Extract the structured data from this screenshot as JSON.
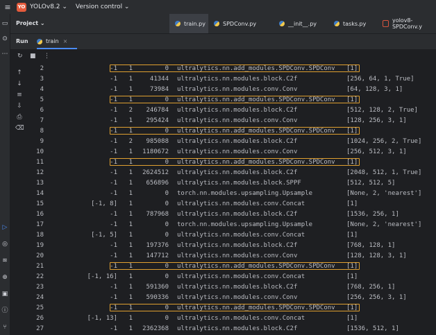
{
  "topbar": {
    "project_badge": "YO",
    "project_name": "YOLOv8.2 ⌄",
    "version_control": "Version control ⌄"
  },
  "editor": {
    "project_label": "Project ⌄",
    "tabs": [
      {
        "label": "train.py",
        "kind": "py"
      },
      {
        "label": "SPDConv.py",
        "kind": "py"
      },
      {
        "label": "__init__.py",
        "kind": "py"
      },
      {
        "label": "tasks.py",
        "kind": "py"
      },
      {
        "label": "yolov8-SPDConv.y",
        "kind": "yaml"
      }
    ]
  },
  "run": {
    "label": "Run",
    "tab": "train",
    "close": "×"
  },
  "colors": {
    "highlight": "#e0a030",
    "accent": "#4b8cf7"
  },
  "rows": [
    {
      "ln": "2",
      "from": "-1",
      "n": "1",
      "params": "0",
      "module": "ultralytics.nn.add_modules.SPDConv.SPDConv",
      "args": "[1]",
      "hl": true
    },
    {
      "ln": "3",
      "from": "-1",
      "n": "1",
      "params": "41344",
      "module": "ultralytics.nn.modules.block.C2f",
      "args": "[256, 64, 1, True]",
      "hl": false
    },
    {
      "ln": "4",
      "from": "-1",
      "n": "1",
      "params": "73984",
      "module": "ultralytics.nn.modules.conv.Conv",
      "args": "[64, 128, 3, 1]",
      "hl": false
    },
    {
      "ln": "5",
      "from": "-1",
      "n": "1",
      "params": "0",
      "module": "ultralytics.nn.add_modules.SPDConv.SPDConv",
      "args": "[1]",
      "hl": true
    },
    {
      "ln": "6",
      "from": "-1",
      "n": "2",
      "params": "246784",
      "module": "ultralytics.nn.modules.block.C2f",
      "args": "[512, 128, 2, True]",
      "hl": false
    },
    {
      "ln": "7",
      "from": "-1",
      "n": "1",
      "params": "295424",
      "module": "ultralytics.nn.modules.conv.Conv",
      "args": "[128, 256, 3, 1]",
      "hl": false
    },
    {
      "ln": "8",
      "from": "-1",
      "n": "1",
      "params": "0",
      "module": "ultralytics.nn.add_modules.SPDConv.SPDConv",
      "args": "[1]",
      "hl": true
    },
    {
      "ln": "9",
      "from": "-1",
      "n": "2",
      "params": "985088",
      "module": "ultralytics.nn.modules.block.C2f",
      "args": "[1024, 256, 2, True]",
      "hl": false
    },
    {
      "ln": "10",
      "from": "-1",
      "n": "1",
      "params": "1180672",
      "module": "ultralytics.nn.modules.conv.Conv",
      "args": "[256, 512, 3, 1]",
      "hl": false
    },
    {
      "ln": "11",
      "from": "-1",
      "n": "1",
      "params": "0",
      "module": "ultralytics.nn.add_modules.SPDConv.SPDConv",
      "args": "[1]",
      "hl": true
    },
    {
      "ln": "12",
      "from": "-1",
      "n": "1",
      "params": "2624512",
      "module": "ultralytics.nn.modules.block.C2f",
      "args": "[2048, 512, 1, True]",
      "hl": false
    },
    {
      "ln": "13",
      "from": "-1",
      "n": "1",
      "params": "656896",
      "module": "ultralytics.nn.modules.block.SPPF",
      "args": "[512, 512, 5]",
      "hl": false
    },
    {
      "ln": "14",
      "from": "-1",
      "n": "1",
      "params": "0",
      "module": "torch.nn.modules.upsampling.Upsample",
      "args": "[None, 2, 'nearest']",
      "hl": false
    },
    {
      "ln": "15",
      "from": "[-1, 8]",
      "n": "1",
      "params": "0",
      "module": "ultralytics.nn.modules.conv.Concat",
      "args": "[1]",
      "hl": false
    },
    {
      "ln": "16",
      "from": "-1",
      "n": "1",
      "params": "787968",
      "module": "ultralytics.nn.modules.block.C2f",
      "args": "[1536, 256, 1]",
      "hl": false
    },
    {
      "ln": "17",
      "from": "-1",
      "n": "1",
      "params": "0",
      "module": "torch.nn.modules.upsampling.Upsample",
      "args": "[None, 2, 'nearest']",
      "hl": false
    },
    {
      "ln": "18",
      "from": "[-1, 5]",
      "n": "1",
      "params": "0",
      "module": "ultralytics.nn.modules.conv.Concat",
      "args": "[1]",
      "hl": false
    },
    {
      "ln": "19",
      "from": "-1",
      "n": "1",
      "params": "197376",
      "module": "ultralytics.nn.modules.block.C2f",
      "args": "[768, 128, 1]",
      "hl": false
    },
    {
      "ln": "20",
      "from": "-1",
      "n": "1",
      "params": "147712",
      "module": "ultralytics.nn.modules.conv.Conv",
      "args": "[128, 128, 3, 1]",
      "hl": false
    },
    {
      "ln": "21",
      "from": "-1",
      "n": "1",
      "params": "0",
      "module": "ultralytics.nn.add_modules.SPDConv.SPDConv",
      "args": "[1]",
      "hl": true
    },
    {
      "ln": "22",
      "from": "[-1, 16]",
      "n": "1",
      "params": "0",
      "module": "ultralytics.nn.modules.conv.Concat",
      "args": "[1]",
      "hl": false
    },
    {
      "ln": "23",
      "from": "-1",
      "n": "1",
      "params": "591360",
      "module": "ultralytics.nn.modules.block.C2f",
      "args": "[768, 256, 1]",
      "hl": false
    },
    {
      "ln": "24",
      "from": "-1",
      "n": "1",
      "params": "590336",
      "module": "ultralytics.nn.modules.conv.Conv",
      "args": "[256, 256, 3, 1]",
      "hl": false
    },
    {
      "ln": "25",
      "from": "-1",
      "n": "1",
      "params": "0",
      "module": "ultralytics.nn.add_modules.SPDConv.SPDConv",
      "args": "[1]",
      "hl": true
    },
    {
      "ln": "26",
      "from": "[-1, 13]",
      "n": "1",
      "params": "0",
      "module": "ultralytics.nn.modules.conv.Concat",
      "args": "[1]",
      "hl": false
    },
    {
      "ln": "27",
      "from": "-1",
      "n": "1",
      "params": "2362368",
      "module": "ultralytics.nn.modules.block.C2f",
      "args": "[1536, 512, 1]",
      "hl": false
    }
  ]
}
